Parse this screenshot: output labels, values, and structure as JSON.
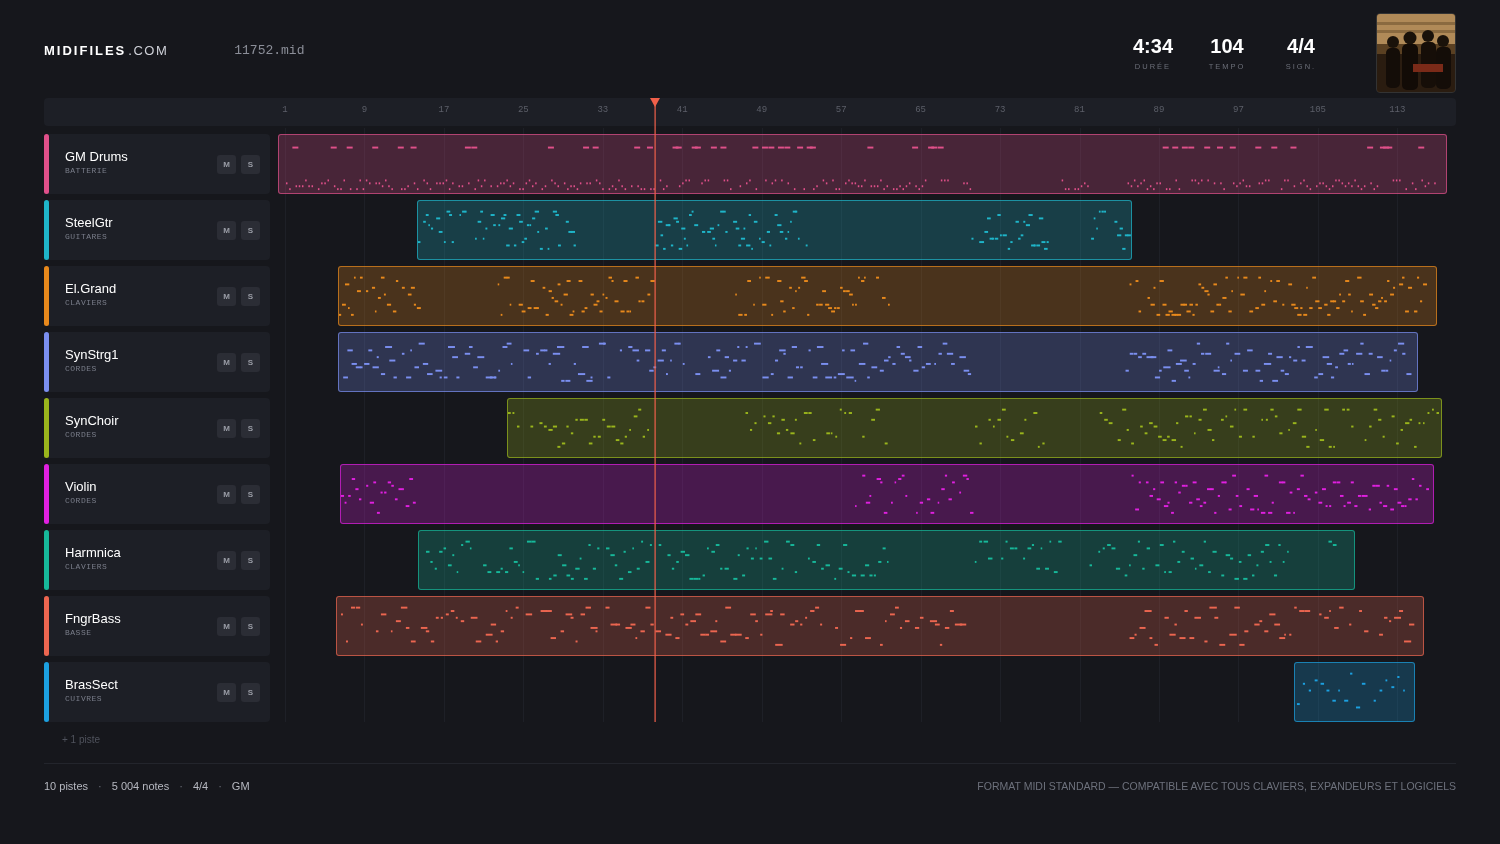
{
  "brand": {
    "name": "MIDIFILES",
    "suffix": ".COM"
  },
  "file": "11752.mid",
  "stats": [
    {
      "value": "4:34",
      "label": "DURÉE"
    },
    {
      "value": "104",
      "label": "TEMPO"
    },
    {
      "value": "4/4",
      "label": "SIGN."
    }
  ],
  "ruler": [
    "1",
    "9",
    "17",
    "25",
    "33",
    "41",
    "49",
    "57",
    "65",
    "73",
    "81",
    "89",
    "97",
    "105",
    "113"
  ],
  "tracks": [
    {
      "name": "GM Drums",
      "category": "BATTERIE",
      "color": "#e0508a",
      "mute": "M",
      "solo": "S"
    },
    {
      "name": "SteelGtr",
      "category": "GUITARES",
      "color": "#1fb5c9",
      "mute": "M",
      "solo": "S"
    },
    {
      "name": "El.Grand",
      "category": "CLAVIERS",
      "color": "#e8891c",
      "mute": "M",
      "solo": "S"
    },
    {
      "name": "SynStrg1",
      "category": "CORDES",
      "color": "#7b8ff0",
      "mute": "M",
      "solo": "S"
    },
    {
      "name": "SynChoir",
      "category": "CORDES",
      "color": "#9ab51c",
      "mute": "M",
      "solo": "S"
    },
    {
      "name": "Violin",
      "category": "CORDES",
      "color": "#e020e0",
      "mute": "M",
      "solo": "S"
    },
    {
      "name": "Harmnica",
      "category": "CLAVIERS",
      "color": "#17b89a",
      "mute": "M",
      "solo": "S"
    },
    {
      "name": "FngrBass",
      "category": "BASSE",
      "color": "#ec6650",
      "mute": "M",
      "solo": "S"
    },
    {
      "name": "BrasSect",
      "category": "CUIVRES",
      "color": "#1ca0e0",
      "mute": "M",
      "solo": "S"
    }
  ],
  "more_tracks": "+ 1 piste",
  "footer": {
    "summary": [
      "10 pistes",
      "5 004 notes",
      "4/4",
      "GM"
    ],
    "separator": "·",
    "note": "FORMAT MIDI STANDARD — COMPATIBLE AVEC TOUS CLAVIERS, EXPANDEURS ET LOGICIELS"
  }
}
